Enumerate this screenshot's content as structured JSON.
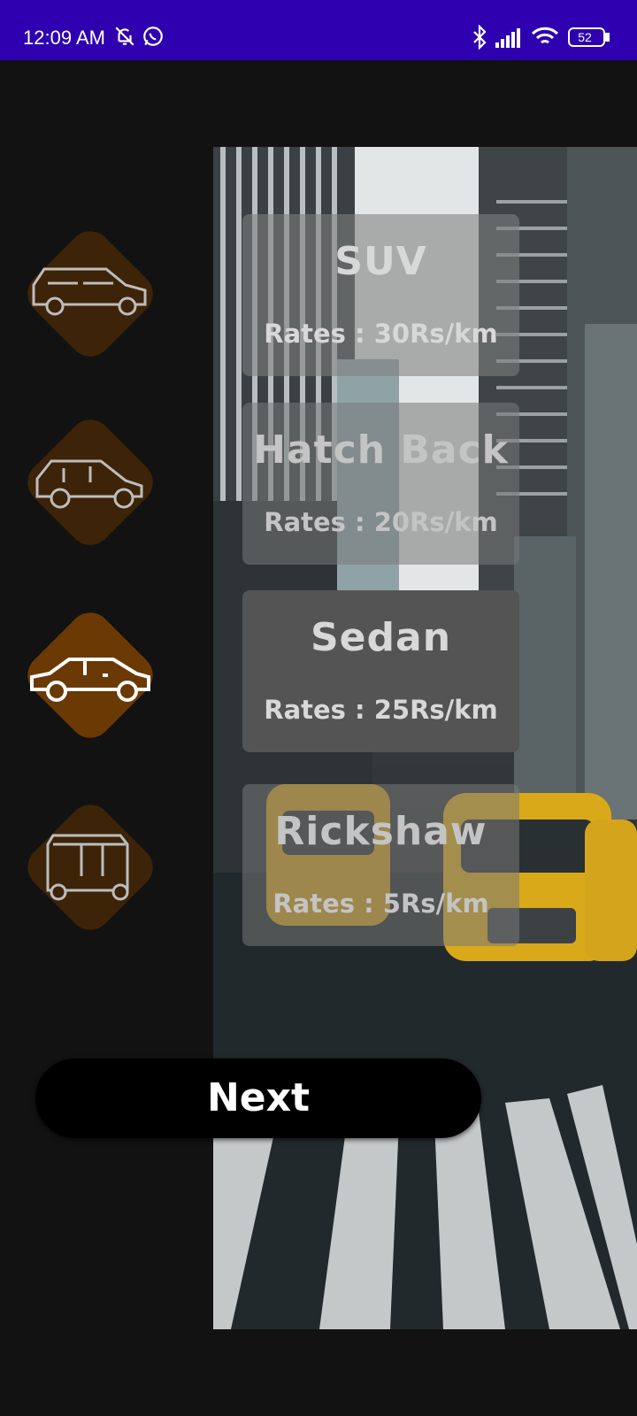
{
  "status_bar": {
    "time": "12:09 AM",
    "battery": "52",
    "icons": [
      "mute-notification-icon",
      "whatsapp-icon",
      "bluetooth-icon",
      "signal-icon",
      "wifi-icon",
      "battery-icon"
    ]
  },
  "vehicle_icons": [
    {
      "name": "suv-icon",
      "selected": false
    },
    {
      "name": "hatchback-icon",
      "selected": false
    },
    {
      "name": "sedan-icon",
      "selected": true
    },
    {
      "name": "rickshaw-icon",
      "selected": false
    }
  ],
  "cards": [
    {
      "title": "SUV",
      "rate": "Rates : 30Rs/km"
    },
    {
      "title": "Hatch Back",
      "rate": "Rates : 20Rs/km"
    },
    {
      "title": "Sedan",
      "rate": "Rates : 25Rs/km"
    },
    {
      "title": "Rickshaw",
      "rate": "Rates : 5Rs/km"
    }
  ],
  "next_button": {
    "label": "Next"
  },
  "colors": {
    "status_bar": "#2e00b0",
    "background": "#121212",
    "diamond": "#3d2408",
    "diamond_selected": "#6b3903",
    "button": "#000000"
  }
}
